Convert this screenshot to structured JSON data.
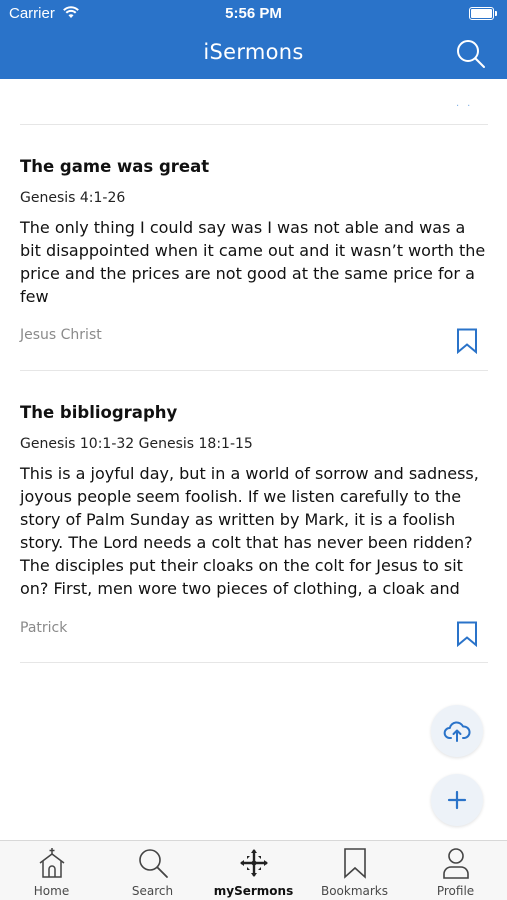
{
  "status_bar": {
    "carrier": "Carrier",
    "time": "5:56 PM"
  },
  "header": {
    "title": "iSermons"
  },
  "colors": {
    "header_bg": "#2a73c9",
    "accent": "#2a73c9"
  },
  "sermons": [
    {
      "title": "The game was great",
      "reference": "Genesis 4:1-26",
      "excerpt": "The only thing I could say was I was not able and was a bit disappointed when it came out and it wasn’t worth the price and the prices are not good at the same price for a few",
      "author": "Jesus Christ"
    },
    {
      "title": "The bibliography",
      "reference": "Genesis 10:1-32 Genesis 18:1-15",
      "excerpt": "This is a joyful day, but in a world of sorrow and sadness, joyous people seem foolish. If we listen carefully to the story of Palm Sunday as written by Mark, it is a foolish story. The Lord needs a colt that has never been ridden? The disciples put their cloaks on the colt for Jesus to sit on? First, men wore two pieces of clothing, a cloak and",
      "author": "Patrick"
    }
  ],
  "tabs": [
    {
      "label": "Home",
      "icon": "home-icon"
    },
    {
      "label": "Search",
      "icon": "search-icon"
    },
    {
      "label": "mySermons",
      "icon": "cross-icon"
    },
    {
      "label": "Bookmarks",
      "icon": "bookmark-icon"
    },
    {
      "label": "Profile",
      "icon": "profile-icon"
    }
  ]
}
